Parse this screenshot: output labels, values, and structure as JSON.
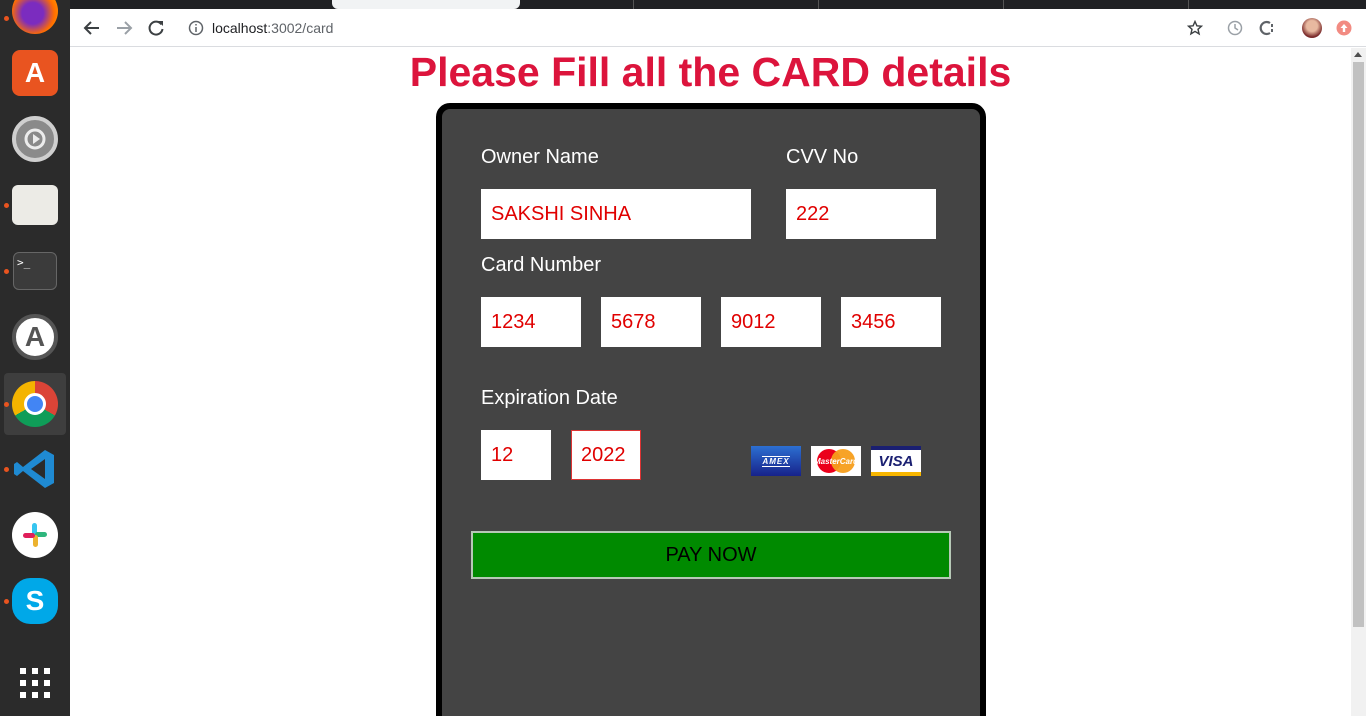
{
  "browser": {
    "url_host": "localhost",
    "url_path": ":3002/card"
  },
  "dock": {
    "apps": [
      "firefox-icon",
      "software-center-icon",
      "settings-icon",
      "files-icon",
      "terminal-icon",
      "software-updater-icon",
      "chrome-icon",
      "vscode-icon",
      "slack-icon",
      "skype-icon",
      "show-apps-icon"
    ],
    "terminal_glyph": ">_"
  },
  "page": {
    "heading": "Please Fill all the CARD details"
  },
  "form": {
    "owner_label": "Owner Name",
    "owner_value": "SAKSHI SINHA",
    "cvv_label": "CVV No",
    "cvv_value": "222",
    "card_number_label": "Card Number",
    "card_number": [
      "1234",
      "5678",
      "9012",
      "3456"
    ],
    "expiration_label": "Expiration Date",
    "exp_month": "12",
    "exp_year": "2022",
    "card_logos": [
      "AMEX",
      "MasterCard",
      "VISA"
    ],
    "pay_button": "PAY NOW"
  },
  "colors": {
    "heading": "#dc143c",
    "panel": "#444444",
    "input_text": "#e00000",
    "pay_button": "#008a00"
  }
}
